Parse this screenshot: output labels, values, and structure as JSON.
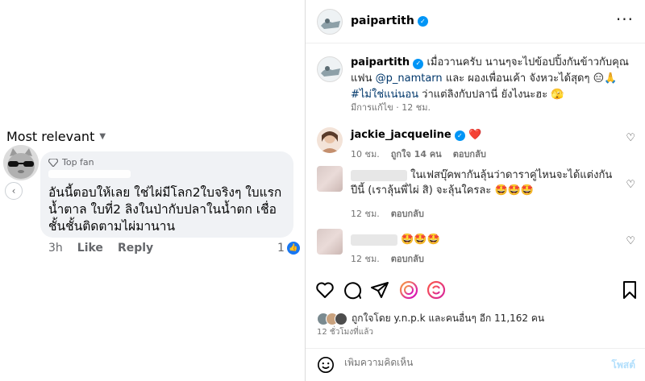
{
  "facebook": {
    "sort_label": "Most relevant",
    "badge": "Top fan",
    "comment_text": "อันนี้ตอบให้เลย ใช่ไผ่มีโลก2ใบจริงๆ ใบแรกน้ำตาล ใบที่2 ลิงในป่ากับปลาในน้ำตก เชื่อชั้นชั้นติดตามไผ่มานาน",
    "time": "3h",
    "like_label": "Like",
    "reply_label": "Reply",
    "reaction_count": "1"
  },
  "instagram": {
    "header_handle": "paipartith",
    "caption": {
      "handle": "paipartith",
      "text_1": "เมื่อวานครับ นานๆจะไปข้อปปิ้งกันข้าวกับคุณแฟน",
      "mention": "@p_namtarn",
      "text_2": "และ ผองเพื่อนเค้า จังหวะได้สุดๆ 😑🙏",
      "hashtag": "#ไม่ใช่แน่นอน",
      "text_3": "ว่าแต่ลิงกับปลานี่ ยังไงนะฮะ 🫣"
    },
    "caption_meta": "มีการแก้ไข · 12 ชม.",
    "comments": [
      {
        "user": "jackie_jacqueline",
        "text": "❤️",
        "time": "10 ชม.",
        "likes": "ถูกใจ 14 คน",
        "reply": "ตอบกลับ"
      },
      {
        "text": "ในเฟสบุ๊คพากันลุ้นว่าดาราคู่ไหนจะได้แต่งกันปีนี้ (เราลุ้นพี่ไผ่ สิ) จะลุ้นใครละ 🤩🤩🤩",
        "time": "12 ชม.",
        "reply": "ตอบกลับ"
      },
      {
        "text": "🤩🤩🤩",
        "time": "12 ชม.",
        "reply": "ตอบกลับ"
      }
    ],
    "likes_text": "ถูกใจโดย y.n.p.k และคนอื่นๆ อีก 11,162 คน",
    "post_time": "12 ชั่วโมงที่แล้ว",
    "add_comment_placeholder": "เพิ่มความคิดเห็น",
    "post_label": "โพสต์"
  },
  "colors": {
    "fb_blue": "#1877f2",
    "ig_link": "#00376b",
    "ig_verified": "#0095f6",
    "ig_post_disabled": "#b2dffc"
  }
}
